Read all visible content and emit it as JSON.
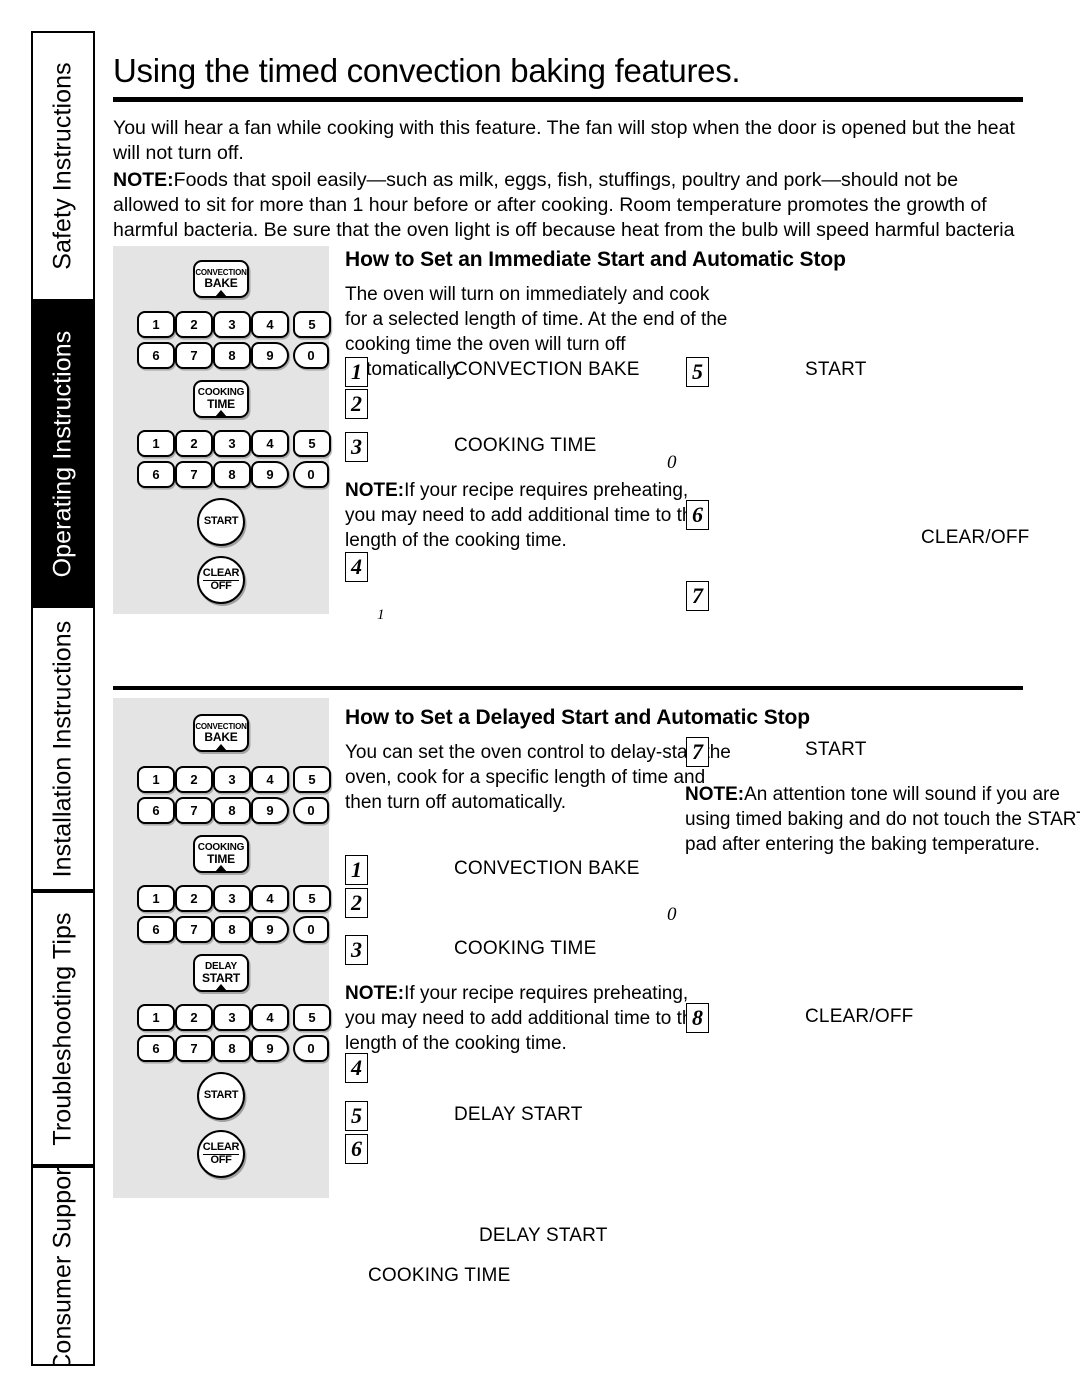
{
  "sidebar": {
    "tabs": [
      {
        "label": "Safety Instructions",
        "active": false
      },
      {
        "label": "Operating Instructions",
        "active": true
      },
      {
        "label": "Installation Instructions",
        "active": false
      },
      {
        "label": "Troubleshooting Tips",
        "active": false
      },
      {
        "label": "Consumer Support",
        "active": false
      }
    ]
  },
  "page": {
    "title": "Using the timed convection baking features.",
    "intro1": "You will hear a fan while cooking with this feature. The fan will stop when the door is opened but the heat will not turn off.",
    "intro2_note": "NOTE:",
    "intro2": "Foods that spoil easily—such as milk, eggs, fish, stuffings, poultry and pork—should not be allowed to sit for more than 1 hour before or after cooking. Room temperature promotes the growth of harmful bacteria. Be sure that the oven light is off because heat from the bulb will speed harmful bacteria growth."
  },
  "controls": {
    "convection_bake_l1": "CONVECTION",
    "convection_bake_l2": "BAKE",
    "cooking_time_l1": "COOKING",
    "cooking_time_l2": "TIME",
    "delay_start_l1": "DELAY",
    "delay_start_l2": "START",
    "start": "START",
    "clear": "CLEAR",
    "off": "OFF",
    "numpad_row1": [
      "1",
      "2",
      "3",
      "4",
      "5"
    ],
    "numpad_row2": [
      "6",
      "7",
      "8",
      "9",
      "0"
    ]
  },
  "section1": {
    "heading": "How to Set an Immediate Start and Automatic Stop",
    "body": "The oven will turn on immediately and cook for a selected length of time. At the end of the cooking time the oven will turn off automatically.",
    "note_lead": "NOTE:",
    "note": "If your recipe requires preheating, you may need to add additional time to the length of the cooking time.",
    "label_convection_bake": "CONVECTION BAKE",
    "label_cooking_time": "COOKING TIME",
    "label_start": "START",
    "label_clear_off": "CLEAR/OFF",
    "step1": "1",
    "step2": "2",
    "step3": "3",
    "step4": "4",
    "step5": "5",
    "step6": "6",
    "step7": "7",
    "stray_zero": "0",
    "stray_one": "1"
  },
  "section2": {
    "heading": "How to Set a Delayed Start and Automatic Stop",
    "body": "You can set the oven control to delay-start the oven, cook for a specific length of time and then turn off automatically.",
    "note1_lead": "NOTE:",
    "note1": "An attention tone will sound if you are using timed baking and do not touch the START pad after entering the baking temperature.",
    "note2_lead": "NOTE:",
    "note2": "If your recipe requires preheating, you may need to add additional time to the length of the cooking time.",
    "label_convection_bake": "CONVECTION BAKE",
    "label_cooking_time": "COOKING TIME",
    "label_delay_start": "DELAY START",
    "label_start": "START",
    "label_clear_off": "CLEAR/OFF",
    "label_delay_start_2": "DELAY START",
    "label_cooking_time_2": "COOKING TIME",
    "step1": "1",
    "step2": "2",
    "step3": "3",
    "step4": "4",
    "step5": "5",
    "step6": "6",
    "step7": "7",
    "step8": "8",
    "stray_zero": "0"
  }
}
